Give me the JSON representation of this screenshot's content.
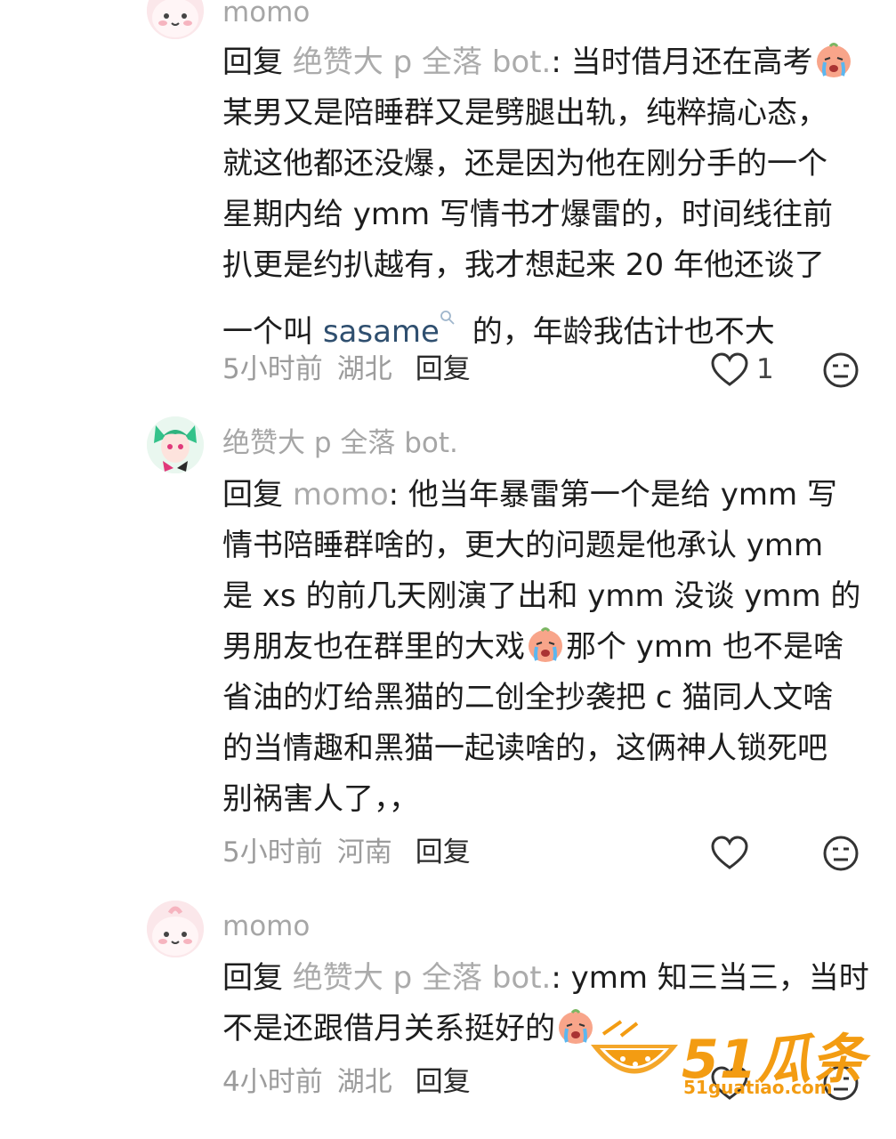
{
  "comments": [
    {
      "author": "momo",
      "reply_prefix": "回复",
      "reply_to": "绝赞大 p 全落 bot.",
      "colon": ":",
      "lines": {
        "l1": " 当时借月还在高考",
        "l2": "某男又是陪睡群又是劈腿出轨，纯粹搞心态，",
        "l3": "就这他都还没爆，还是因为他在刚分手的一个",
        "l4": "星期内给 ymm 写情书才爆雷的，时间线往前",
        "l5": "扒更是约扒越有，我才想起来 20 年他还谈了",
        "l6_pre": "一个叫 ",
        "l6_link": "sasame",
        "l6_post": " 的，年龄我估计也不大"
      },
      "time": "5小时前",
      "location": "湖北",
      "reply_label": "回复",
      "like_count": "1"
    },
    {
      "author": "绝赞大 p 全落 bot.",
      "reply_prefix": "回复",
      "reply_to": "momo",
      "colon": ":",
      "lines": {
        "l1": " 他当年暴雷第一个是给 ymm 写",
        "l2": "情书陪睡群啥的，更大的问题是他承认 ymm",
        "l3": "是 xs 的前几天刚演了出和 ymm 没谈 ymm 的",
        "l4_pre": "男朋友也在群里的大戏",
        "l4_post": "那个 ymm 也不是啥",
        "l5": "省油的灯给黑猫的二创全抄袭把 c 猫同人文啥",
        "l6": "的当情趣和黑猫一起读啥的，这俩神人锁死吧",
        "l7": "别祸害人了，，"
      },
      "time": "5小时前",
      "location": "河南",
      "reply_label": "回复"
    },
    {
      "author": "momo",
      "reply_prefix": "回复",
      "reply_to": "绝赞大 p 全落 bot.",
      "colon": ":",
      "lines": {
        "l1": " ymm 知三当三，当时",
        "l2": "不是还跟借月关系挺好的"
      },
      "time": "4小时前",
      "location": "湖北",
      "reply_label": "回复"
    }
  ],
  "watermark": {
    "brand": "51瓜条",
    "url": "51guatiao.com"
  },
  "icons": {
    "like": "heart-icon",
    "mood": "neutral-face-icon",
    "emoji": "crying-peach-emoji",
    "search": "search-icon"
  },
  "colors": {
    "watermark": "#f39c12",
    "link": "#2f4f6f",
    "secondary_text": "#a6a6a6"
  }
}
